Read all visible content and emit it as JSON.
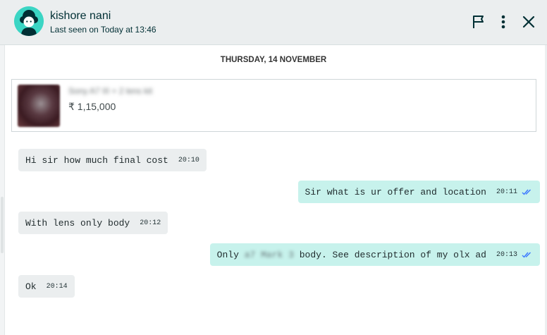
{
  "header": {
    "user_name": "kishore nani",
    "last_seen": "Last seen on Today at 13:46",
    "icons": [
      "flag-icon",
      "more-vertical-icon",
      "close-icon"
    ]
  },
  "conversation": {
    "date_divider": "THURSDAY, 14 NOVEMBER",
    "ad": {
      "title": "Sony A7 III + 2 lens kit",
      "price": "₹ 1,15,000"
    },
    "messages": [
      {
        "direction": "incoming",
        "text": "Hi sir how much final cost",
        "time": "20:10"
      },
      {
        "direction": "outgoing",
        "text": "Sir what is ur offer and location",
        "time": "20:11",
        "status": "read"
      },
      {
        "direction": "incoming",
        "text": "With lens only body",
        "time": "20:12"
      },
      {
        "direction": "outgoing",
        "text_before": "Only",
        "text_redacted": "a7 Mark 3",
        "text_after": "body. See description of my olx ad",
        "time": "20:13",
        "status": "read"
      },
      {
        "direction": "incoming",
        "text": "Ok",
        "time": "20:14"
      }
    ]
  },
  "colors": {
    "header_bg": "#ebeeef",
    "incoming_bubble": "#ebeeef",
    "outgoing_bubble": "#c7f2ec",
    "avatar_bg": "#3bd5c4",
    "read_tick": "#3a77ff"
  }
}
